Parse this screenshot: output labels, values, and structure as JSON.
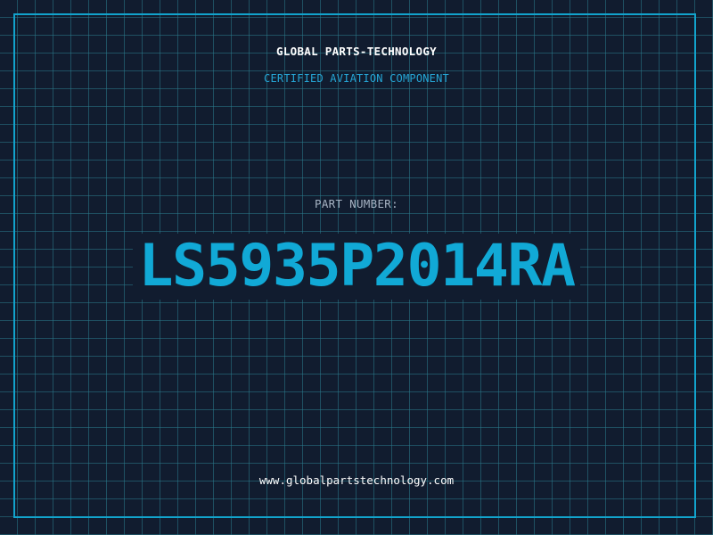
{
  "header": {
    "company": "GLOBAL PARTS-TECHNOLOGY",
    "tagline": "CERTIFIED AVIATION COMPONENT"
  },
  "part": {
    "label": "PART NUMBER:",
    "number": "LS5935P2014RA"
  },
  "footer": {
    "website": "www.globalpartstechnology.com"
  },
  "colors": {
    "background": "#111c2f",
    "grid": "#2a7a8c",
    "accent": "#12a3cc",
    "part_number": "#11a9d6"
  }
}
